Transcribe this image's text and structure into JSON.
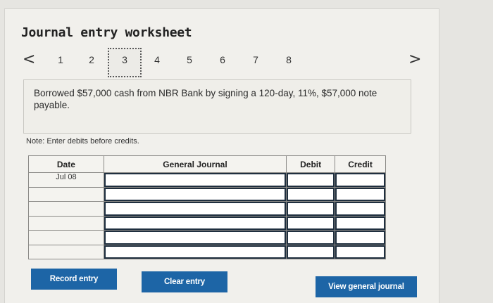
{
  "worksheet": {
    "title": "Journal entry worksheet",
    "nav": {
      "prev_symbol": "<",
      "next_symbol": ">",
      "steps": [
        "1",
        "2",
        "3",
        "4",
        "5",
        "6",
        "7",
        "8"
      ],
      "active_step": "3"
    },
    "prompt": "Borrowed $57,000 cash from NBR Bank by signing a 120-day, 11%, $57,000 note payable.",
    "note": "Note: Enter debits before credits.",
    "table": {
      "headers": {
        "date": "Date",
        "general_journal": "General Journal",
        "debit": "Debit",
        "credit": "Credit"
      },
      "rows": [
        {
          "date": "Jul 08",
          "account": "",
          "debit": "",
          "credit": ""
        },
        {
          "date": "",
          "account": "",
          "debit": "",
          "credit": ""
        },
        {
          "date": "",
          "account": "",
          "debit": "",
          "credit": ""
        },
        {
          "date": "",
          "account": "",
          "debit": "",
          "credit": ""
        },
        {
          "date": "",
          "account": "",
          "debit": "",
          "credit": ""
        },
        {
          "date": "",
          "account": "",
          "debit": "",
          "credit": ""
        }
      ]
    },
    "buttons": {
      "record": "Record entry",
      "clear": "Clear entry",
      "view": "View general journal"
    }
  }
}
